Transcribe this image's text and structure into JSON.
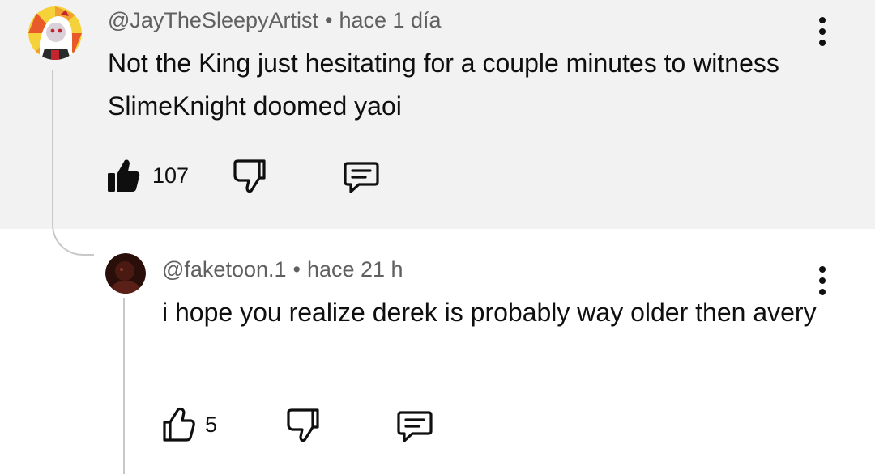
{
  "comments": {
    "main": {
      "author": "@JayTheSleepyArtist",
      "separator": "•",
      "time": "hace 1 día",
      "text": "Not the King just hesitating for a couple minutes to witness SlimeKnight doomed yaoi",
      "likes": "107",
      "like_state": "liked"
    },
    "reply": {
      "author": "@faketoon.1",
      "separator": "•",
      "time": "hace 21 h",
      "text": "i hope you realize derek is probably way older then avery",
      "likes": "5",
      "like_state": "not-liked"
    }
  },
  "icons": {
    "like_filled": "thumbs-up-filled-icon",
    "like_outline": "thumbs-up-icon",
    "dislike": "thumbs-down-icon",
    "reply": "reply-comment-icon",
    "menu": "more-vertical-icon"
  },
  "colors": {
    "main_comment_background": "#f2f2f2",
    "reply_background": "#ffffff",
    "meta_text": "#606060",
    "body_text": "#0f0f0f",
    "thread_line": "#c8c8c8"
  }
}
